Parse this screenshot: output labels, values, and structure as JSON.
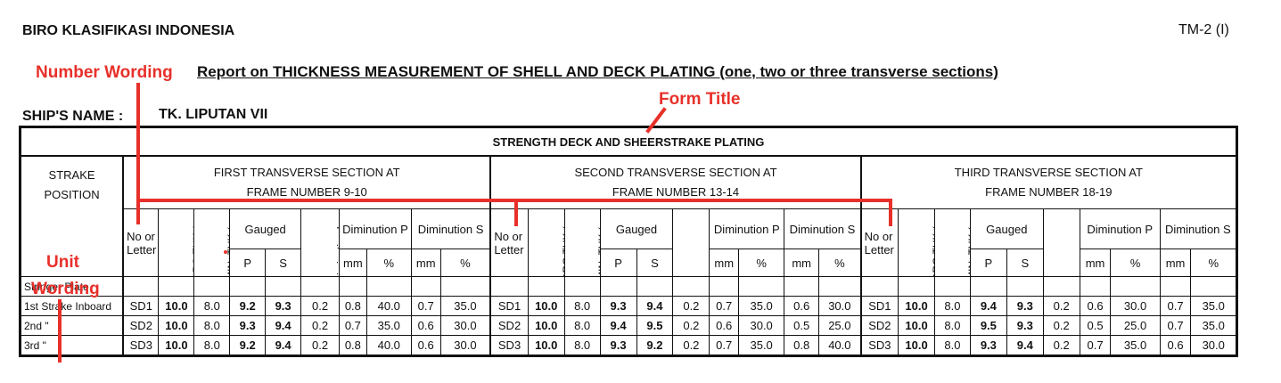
{
  "header": {
    "organization": "BIRO KLASIFIKASI INDONESIA",
    "form_code": "TM-2 (I)"
  },
  "report_title": "Report on THICKNESS MEASUREMENT OF SHELL AND DECK PLATING (one, two or three transverse sections)",
  "ship": {
    "label": "SHIP'S NAME :",
    "name": "TK. LIPUTAN VII"
  },
  "annotations": {
    "number_wording": "Number Wording",
    "form_title": "Form Title",
    "unit_line1": "Unit",
    "unit_line2": "Wording",
    "color": "#e8302a"
  },
  "table": {
    "band_title": "STRENGTH DECK AND SHEERSTRAKE PLATING",
    "strake_header": "STRAKE POSITION",
    "sections": [
      {
        "line1": "FIRST TRANSVERSE SECTION AT",
        "line2": "FRAME NUMBER 9-10"
      },
      {
        "line1": "SECOND TRANSVERSE SECTION AT",
        "line2": "FRAME NUMBER 13-14"
      },
      {
        "line1": "THIRD TRANSVERSE SECTION AT",
        "line2": "FRAME NUMBER 18-19"
      }
    ],
    "columns": {
      "no_or_letter": "No or Letter",
      "org_thk": "ORG THK (mm)",
      "min_thk": "MIN. THK (mm)",
      "gauged": "Gauged",
      "diminution_level": "Diminution Level",
      "diminution_p": "Diminution P",
      "diminution_s": "Diminution S",
      "p": "P",
      "s": "S",
      "mm": "mm",
      "pct": "%"
    },
    "rows": [
      {
        "position": "Stringer Plate",
        "sections": []
      },
      {
        "position": "1st Strake Inboard",
        "sections": [
          [
            "SD1",
            "10.0",
            "8.0",
            "9.2",
            "9.3",
            "0.2",
            "0.8",
            "40.0",
            "0.7",
            "35.0"
          ],
          [
            "SD1",
            "10.0",
            "8.0",
            "9.3",
            "9.4",
            "0.2",
            "0.7",
            "35.0",
            "0.6",
            "30.0"
          ],
          [
            "SD1",
            "10.0",
            "8.0",
            "9.4",
            "9.3",
            "0.2",
            "0.6",
            "30.0",
            "0.7",
            "35.0"
          ]
        ]
      },
      {
        "position": "2nd       \"",
        "sections": [
          [
            "SD2",
            "10.0",
            "8.0",
            "9.3",
            "9.4",
            "0.2",
            "0.7",
            "35.0",
            "0.6",
            "30.0"
          ],
          [
            "SD2",
            "10.0",
            "8.0",
            "9.4",
            "9.5",
            "0.2",
            "0.6",
            "30.0",
            "0.5",
            "25.0"
          ],
          [
            "SD2",
            "10.0",
            "8.0",
            "9.5",
            "9.3",
            "0.2",
            "0.5",
            "25.0",
            "0.7",
            "35.0"
          ]
        ]
      },
      {
        "position": "3rd       \"",
        "sections": [
          [
            "SD3",
            "10.0",
            "8.0",
            "9.2",
            "9.4",
            "0.2",
            "0.8",
            "40.0",
            "0.6",
            "30.0"
          ],
          [
            "SD3",
            "10.0",
            "8.0",
            "9.3",
            "9.2",
            "0.2",
            "0.7",
            "35.0",
            "0.8",
            "40.0"
          ],
          [
            "SD3",
            "10.0",
            "8.0",
            "9.3",
            "9.4",
            "0.2",
            "0.7",
            "35.0",
            "0.6",
            "30.0"
          ]
        ]
      }
    ]
  }
}
